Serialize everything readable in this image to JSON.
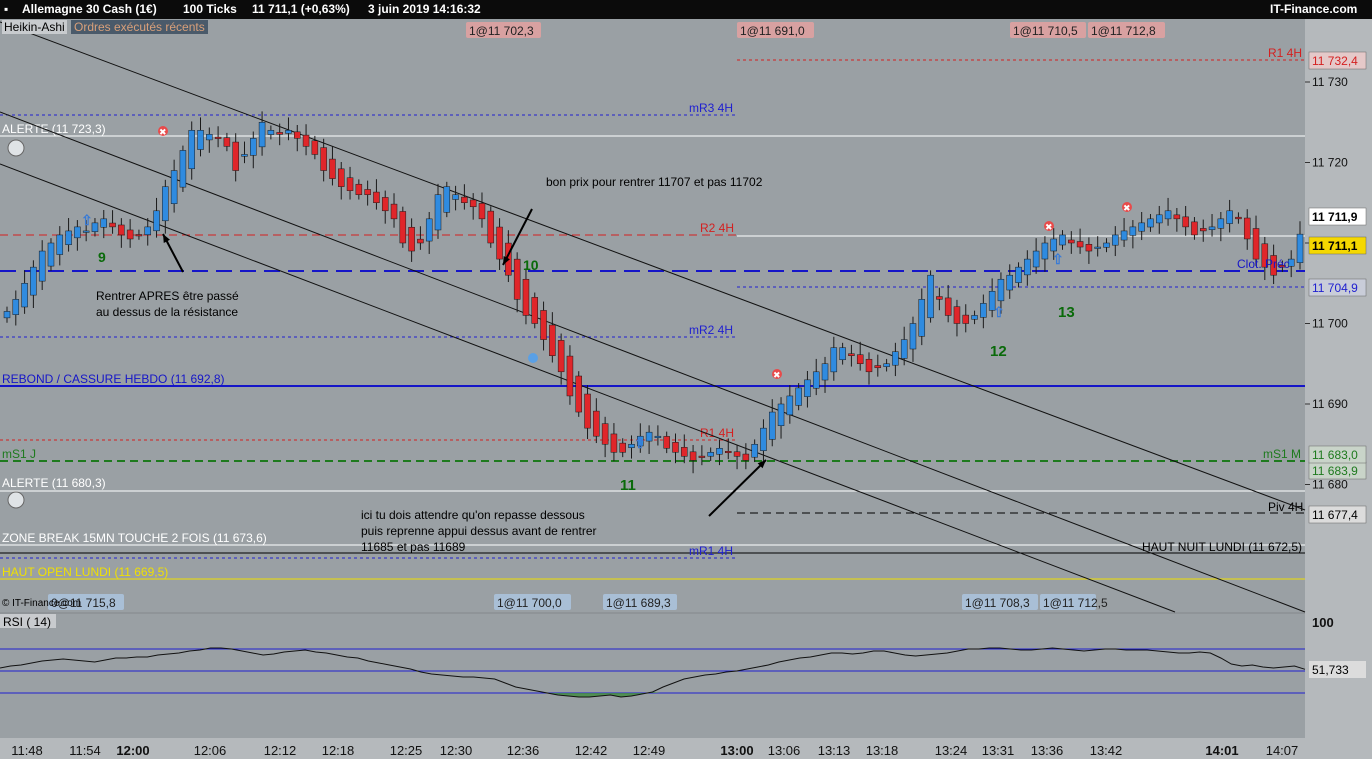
{
  "titlebar": {
    "instrument": "Allemagne 30 Cash (1€)",
    "ticks": "100 Ticks",
    "quote": "11 711,1 (+0,63%)",
    "datetime": "3 juin 2019 14:16:32",
    "brand": "IT-Finance.com"
  },
  "toolbar": {
    "heikin": "Heikin-Ashi",
    "recent_orders": "Ordres exécutés récents"
  },
  "watermark": "© IT-Finance.com",
  "colors": {
    "up": "#2f8be0",
    "down": "#e0262a",
    "price_tag": "#f5d800",
    "support": "#1515c8"
  },
  "chart_data": [
    {
      "type": "candlestick",
      "name": "DAX 100 ticks Heikin-Ashi",
      "ylim": [
        11664,
        11738
      ],
      "y_ticks": [
        11680,
        11690,
        11700,
        11710,
        11720,
        11730
      ],
      "y_tick_labels": [
        "11 680",
        "11 690",
        "11 700",
        "11 710",
        "11 720",
        "11 730"
      ],
      "x_ticks": [
        "11:48",
        "11:54",
        "12:00",
        "12:06",
        "12:12",
        "12:18",
        "12:25",
        "12:30",
        "12:36",
        "12:42",
        "12:49",
        "13:00",
        "13:06",
        "13:13",
        "13:18",
        "13:24",
        "13:31",
        "13:36",
        "13:42",
        "14:01",
        "14:07"
      ],
      "bold_x_ticks": [
        "12:00",
        "13:00",
        "14:01"
      ],
      "candles_note": "close sequence per bar (index 0 = left)",
      "closes": [
        11701.5,
        11703,
        11705,
        11707,
        11709,
        11710,
        11711,
        11711.5,
        11712,
        11711.5,
        11712.5,
        11713,
        11712,
        11711,
        11710.5,
        11711,
        11712,
        11714,
        11717,
        11719,
        11721.5,
        11724,
        11724,
        11723.5,
        11723,
        11722,
        11719,
        11721,
        11723,
        11725,
        11724,
        11723.5,
        11724,
        11723,
        11722,
        11721,
        11719,
        11718,
        11717,
        11716.5,
        11716,
        11716,
        11715,
        11714,
        11713,
        11710,
        11709,
        11710,
        11713,
        11716,
        11717,
        11716,
        11715,
        11714.5,
        11713,
        11710,
        11708,
        11706,
        11703,
        11701,
        11700,
        11698,
        11696,
        11694,
        11691,
        11689,
        11687,
        11686,
        11685,
        11684,
        11684,
        11685,
        11686,
        11686.5,
        11686,
        11684.5,
        11684,
        11683.5,
        11683,
        11683.5,
        11684,
        11684.5,
        11684,
        11683.5,
        11683,
        11685,
        11687,
        11689,
        11690,
        11691,
        11692,
        11693,
        11694,
        11695,
        11697,
        11697,
        11696,
        11695,
        11694,
        11694.5,
        11695,
        11696.5,
        11698,
        11700,
        11703,
        11706,
        11703,
        11701,
        11700,
        11700,
        11701,
        11702.5,
        11704,
        11705.5,
        11706,
        11707,
        11708,
        11709,
        11710,
        11710.5,
        11711,
        11710,
        11709.5,
        11709,
        11709.5,
        11710,
        11711,
        11711.5,
        11712,
        11712.5,
        11713,
        11713.5,
        11714,
        11713,
        11712,
        11711,
        11711.5,
        11712,
        11713,
        11714,
        11713,
        11710.5,
        11708,
        11707,
        11706,
        11707,
        11708,
        11711.1
      ],
      "channel_lines": [
        {
          "from": [
            "11:48",
            11738
          ],
          "to": [
            "14:07",
            11676
          ]
        },
        {
          "from": [
            "11:48",
            11728
          ],
          "to": [
            "14:07",
            11670
          ]
        },
        {
          "from": [
            "11:48",
            11720
          ],
          "to": [
            "14:07",
            11664
          ]
        }
      ]
    },
    {
      "type": "line",
      "name": "RSI (14)",
      "ylim": [
        0,
        100
      ],
      "y_tick_labels": [
        "100"
      ],
      "last_value_label": "51,733",
      "values": [
        53,
        55,
        56,
        58,
        60,
        61,
        62,
        61,
        60,
        59,
        61,
        63,
        63,
        64,
        64,
        66,
        67,
        68,
        70,
        71,
        73,
        73,
        72,
        70,
        68,
        66,
        67,
        69,
        70,
        71,
        69,
        68,
        66,
        64,
        63,
        60,
        58,
        56,
        54,
        52,
        49,
        47,
        46,
        45,
        44,
        44,
        43,
        42,
        38,
        34,
        32,
        30,
        28,
        26,
        25,
        24,
        24,
        25,
        26,
        24,
        25,
        27,
        29,
        34,
        38,
        42,
        44,
        46,
        47,
        49,
        50,
        52,
        54,
        56,
        59,
        61,
        63,
        64,
        66,
        68,
        68,
        67,
        68,
        70,
        70,
        68,
        66,
        65,
        66,
        67,
        68,
        70,
        72,
        72,
        73,
        73,
        72,
        71,
        71,
        72,
        73,
        72,
        71,
        70,
        71,
        72,
        72,
        71,
        71,
        71,
        70,
        69,
        68,
        68,
        69,
        68,
        63,
        57,
        55,
        56,
        54,
        53,
        54,
        55,
        51.7
      ]
    }
  ],
  "levels": [
    {
      "label": "R1 4H",
      "price": "11 732,4",
      "color": "#d42020",
      "style": "dotted"
    },
    {
      "label": "mR3 4H",
      "color": "#2020d0",
      "style": "dotted"
    },
    {
      "label": "ALERTE (11 723,3)",
      "color": "#ffffff",
      "style": "solid"
    },
    {
      "label": "R2 4H",
      "color": "#d42020",
      "style": "dashed"
    },
    {
      "label": "mR2 4H",
      "color": "#2020d0",
      "style": "dotted"
    },
    {
      "label": "REBOND / CASSURE HEBDO (11 692,8)",
      "color": "#1515c8",
      "style": "solid"
    },
    {
      "label": "R1 4H",
      "color": "#d42020",
      "style": "dotted"
    },
    {
      "label": "mS1 J",
      "color": "#1e7a1e",
      "style": "dashed"
    },
    {
      "label": "ALERTE (11 680,3)",
      "color": "#ffffff",
      "style": "solid"
    },
    {
      "label": "Piv 4H",
      "price": "11 677,4",
      "color": "#000000",
      "style": "dashed"
    },
    {
      "label": "ZONE BREAK 15MN TOUCHE 2 FOIS (11 673,6)",
      "color": "#ffffff",
      "style": "solid"
    },
    {
      "label": "HAUT NUIT LUNDI (11 672,5)",
      "color": "#000000",
      "style": "solid"
    },
    {
      "label": "mR1 4H",
      "color": "#2020d0",
      "style": "dotted"
    },
    {
      "label": "HAUT OPEN LUNDI (11 669,5)",
      "color": "#f0e000",
      "style": "solid"
    }
  ],
  "price_tags": [
    "11 711,9",
    "11 711,1",
    "11 704,9",
    "11 683,9",
    "11 683,0"
  ],
  "order_tags_top": [
    "1@11 702,3",
    "1@11 691,0",
    "1@11 710,5",
    "1@11 712,8"
  ],
  "order_tags_bottom": [
    "0@11 715,8",
    "1@11 700,0",
    "1@11 689,3",
    "1@11 708,3",
    "1@11 712,5"
  ],
  "annotations": {
    "n9": "9",
    "n10": "10",
    "n11": "11",
    "n12": "12",
    "n13": "13",
    "bon_prix": "bon prix pour rentrer 11707  et pas 11702",
    "rentrer_1": "Rentrer APRES être passé",
    "rentrer_2": "au dessus de la résistance",
    "ici_1": "ici tu dois attendre qu'on repasse dessous",
    "ici_2": " puis reprenne appui dessus avant de rentrer",
    "ici_3": "11685 et pas 11689",
    "clot": "Clot. Préc",
    "ms1_right": "mS1 M"
  },
  "rsi_label": "RSI ( 14)"
}
